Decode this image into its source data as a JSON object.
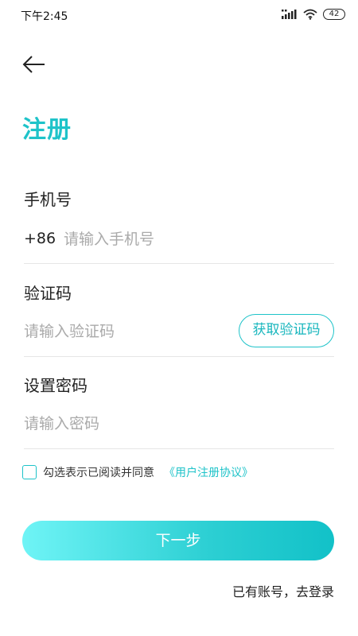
{
  "status_bar": {
    "time": "下午2:45",
    "battery": "42",
    "icons": [
      "signal-icon",
      "wifi-icon",
      "battery-icon"
    ]
  },
  "header": {
    "back_icon": "arrow-left-icon",
    "title": "注册"
  },
  "form": {
    "phone": {
      "label": "手机号",
      "country_code": "+86",
      "placeholder": "请输入手机号",
      "value": ""
    },
    "code": {
      "label": "验证码",
      "placeholder": "请输入验证码",
      "value": "",
      "button_label": "获取验证码"
    },
    "password": {
      "label": "设置密码",
      "placeholder": "请输入密码",
      "value": ""
    }
  },
  "agreement": {
    "checked": false,
    "text": "勾选表示已阅读并同意",
    "link": "《用户注册协议》"
  },
  "actions": {
    "next_label": "下一步",
    "login_label": "已有账号，去登录"
  },
  "colors": {
    "accent": "#1ec3c9",
    "gradient_start": "#6ff4f6",
    "gradient_end": "#12c1c8",
    "placeholder": "#aaaaaa",
    "divider": "#e6e6e6"
  }
}
